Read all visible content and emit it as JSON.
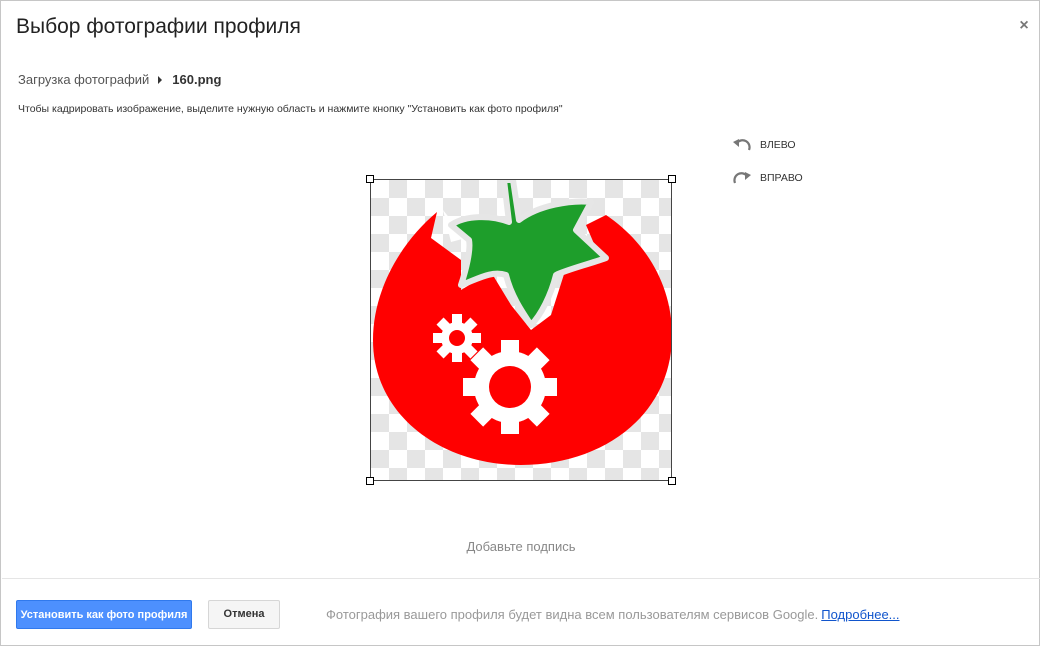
{
  "dialog": {
    "title": "Выбор фотографии профиля",
    "close_symbol": "×"
  },
  "breadcrumb": {
    "parent": "Загрузка фотографий",
    "current": "160.png"
  },
  "instructions": "Чтобы кадрировать изображение, выделите нужную область и нажмите кнопку \"Установить как фото профиля\"",
  "rotate": {
    "left_label": "ВЛЕВО",
    "right_label": "ВПРАВО",
    "left_icon": "rotate-left-icon",
    "right_icon": "rotate-right-icon"
  },
  "image": {
    "description_icon": "tomato-gears-logo",
    "colors": {
      "tomato": "#ff0000",
      "leaf": "#1e9e2b",
      "gears": "#ffffff"
    }
  },
  "caption_placeholder": "Добавьте подпись",
  "footer": {
    "set_button": "Установить как фото профиля",
    "cancel_button": "Отмена",
    "note": "Фотография вашего профиля будет видна всем пользователям сервисов Google.",
    "more_link": "Подробнее..."
  },
  "colors": {
    "primary_button": "#4d90fe",
    "link": "#1155cc"
  }
}
